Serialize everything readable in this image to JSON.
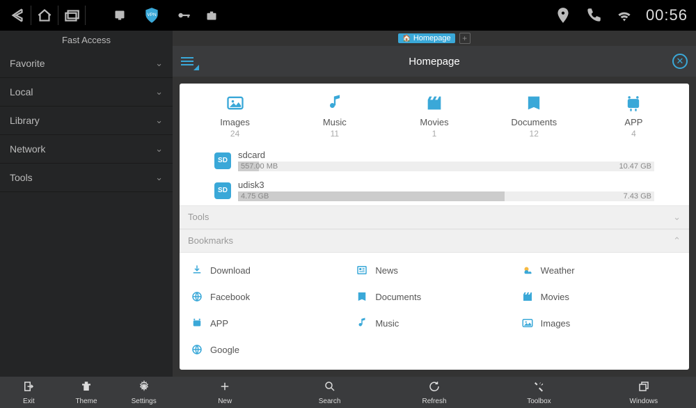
{
  "statusbar": {
    "time": "00:56"
  },
  "sidebar": {
    "title": "Fast Access",
    "items": [
      {
        "label": "Favorite"
      },
      {
        "label": "Local"
      },
      {
        "label": "Library"
      },
      {
        "label": "Network"
      },
      {
        "label": "Tools"
      }
    ]
  },
  "tab": {
    "label": "Homepage"
  },
  "header": {
    "title": "Homepage"
  },
  "categories": [
    {
      "label": "Images",
      "count": "24"
    },
    {
      "label": "Music",
      "count": "11"
    },
    {
      "label": "Movies",
      "count": "1"
    },
    {
      "label": "Documents",
      "count": "12"
    },
    {
      "label": "APP",
      "count": "4"
    }
  ],
  "storage": [
    {
      "name": "sdcard",
      "used": "557.00 MB",
      "total": "10.47 GB",
      "pct": 5
    },
    {
      "name": "udisk3",
      "used": "4.75 GB",
      "total": "7.43 GB",
      "pct": 64
    }
  ],
  "sections": {
    "tools": "Tools",
    "bookmarks": "Bookmarks"
  },
  "bookmarks": [
    {
      "label": "Download",
      "icon": "download"
    },
    {
      "label": "News",
      "icon": "news"
    },
    {
      "label": "Weather",
      "icon": "weather"
    },
    {
      "label": "Facebook",
      "icon": "globe"
    },
    {
      "label": "Documents",
      "icon": "docs"
    },
    {
      "label": "Movies",
      "icon": "movies"
    },
    {
      "label": "APP",
      "icon": "app"
    },
    {
      "label": "Music",
      "icon": "music"
    },
    {
      "label": "Images",
      "icon": "images"
    },
    {
      "label": "Google",
      "icon": "globe"
    }
  ],
  "bottombar": {
    "left": [
      {
        "label": "Exit"
      },
      {
        "label": "Theme"
      },
      {
        "label": "Settings"
      }
    ],
    "right": [
      {
        "label": "New"
      },
      {
        "label": "Search"
      },
      {
        "label": "Refresh"
      },
      {
        "label": "Toolbox"
      },
      {
        "label": "Windows"
      }
    ]
  }
}
